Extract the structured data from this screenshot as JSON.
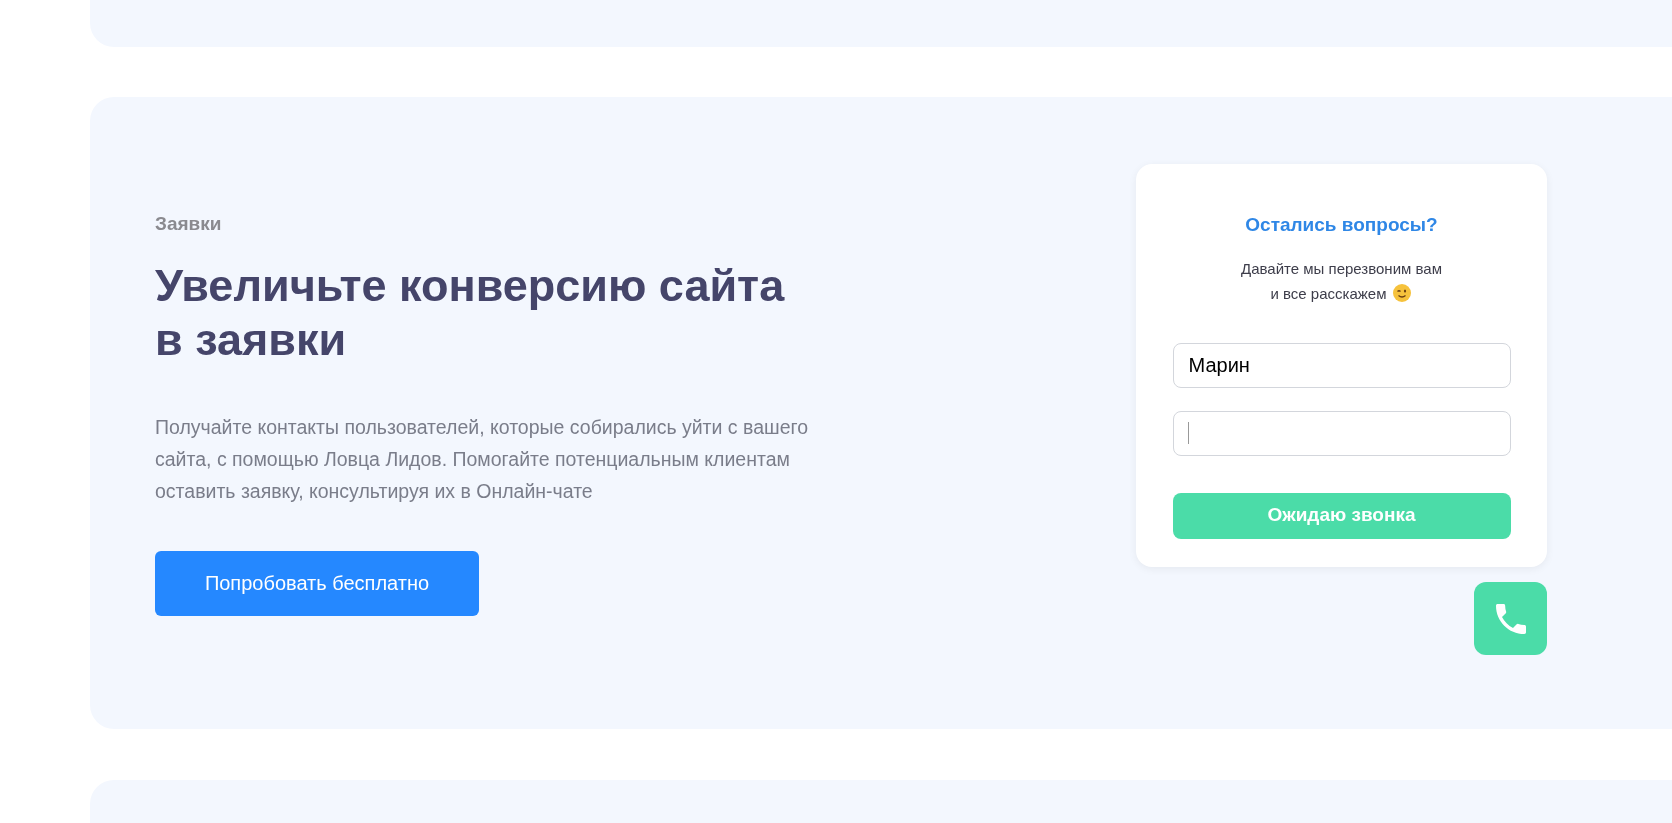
{
  "section": {
    "eyebrow": "Заявки",
    "heading": [
      "Увеличьте конверсию сайта",
      "в заявки"
    ],
    "description": "Получайте контакты пользователей, которые собирались уйти с вашего сайта, с помощью Ловца Лидов. Помогайте потенциальным клиентам оставить заявку, консультируя их в Онлайн-чате",
    "cta_button": "Попробовать бесплатно"
  },
  "callback_form": {
    "title": "Остались вопросы?",
    "subtitle": [
      "Давайте мы перезвоним вам",
      "и все расскажем"
    ],
    "fields": [
      {
        "value": "Марин",
        "focused": false
      },
      {
        "focused": true
      }
    ],
    "submit_button": "Ожидаю звонка"
  }
}
